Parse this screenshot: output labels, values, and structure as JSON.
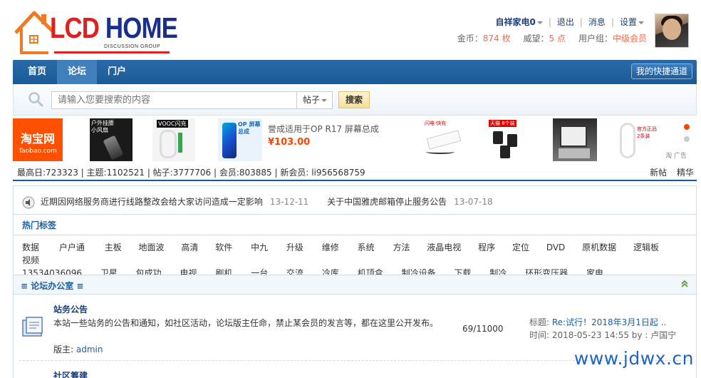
{
  "logo": {
    "part1": "LCD",
    "part2": "HOME",
    "subtitle": "DISCUSSION GROUP"
  },
  "user": {
    "name": "自祥家电0",
    "logout": "退出",
    "messages": "消息",
    "settings": "设置",
    "coins_label": "金币：",
    "coins_value": "874 枚",
    "prestige_label": "威望：",
    "prestige_value": "5 点",
    "group_label": "用户组：",
    "group_value": "中级会员"
  },
  "nav": {
    "items": [
      {
        "label": "首页"
      },
      {
        "label": "论坛",
        "active": true
      },
      {
        "label": "门户"
      }
    ],
    "quick_access": "我的快捷通道"
  },
  "search": {
    "placeholder": "请输入您要搜索的内容",
    "type": "帖子",
    "button": "搜索"
  },
  "ad": {
    "taobao_cn": "淘宝网",
    "taobao_en": "Taobao.com",
    "thumb1_text": "户外挂腰 小风扇",
    "thumb2_text": "VOOC闪充",
    "thumb3_text": "OP 屏幕总成",
    "promo_title": "誉成适用于OP R17 屏幕总成",
    "promo_price": "¥103.00",
    "thumb_usb_text": "闪电·快充",
    "thumb_plug_text": "天猫 8个装",
    "thumb_cable_text": "官方正品 2条装",
    "tag": "淘 广告"
  },
  "stats": {
    "text": "最高日:723323 | 主题:1102521 | 帖子:3777706 | 会员:803885 | 新会员: li956568759",
    "new_posts": "新帖",
    "digest": "精华"
  },
  "notices": [
    {
      "title": "近期因网络服务商进行线路整改会给大家访问造成一定影响",
      "date": "13-12-11"
    },
    {
      "title": "关于中国雅虎邮箱停止服务公告",
      "date": "13-07-18"
    }
  ],
  "hot_tags": {
    "title": "热门标签",
    "tags": [
      "数据",
      "户户通",
      "主板",
      "地面波",
      "高清",
      "软件",
      "中九",
      "升级",
      "维修",
      "系统",
      "方法",
      "液晶电视",
      "程序",
      "定位",
      "DVD",
      "原机数据",
      "逻辑板",
      "视频",
      "13534036096",
      "卫星",
      "包成功",
      "电视",
      "刷机",
      "一台",
      "交流",
      "冷库",
      "机顶盒",
      "制冷设备",
      "下载",
      "制冷",
      "环形变压器",
      "家电"
    ]
  },
  "section": {
    "title": "≡ 论坛办公室 ≡",
    "forums": [
      {
        "name": "站务公告",
        "desc": "本站一些站务的公告和通知，如社区活动，论坛版主任命，禁止某会员的发言等，都在这里公开发布。",
        "moderator_label": "版主: ",
        "moderator": "admin",
        "counts": "69/11000",
        "last_title_label": "标题: ",
        "last_title": "Re:试行！2018年3月1日起 ..",
        "last_time": "时间: 2018-05-23 14:55 by : 卢国宁"
      },
      {
        "name": "社区筹建"
      }
    ]
  },
  "watermark": "www.jdwx.cn",
  "colors": {
    "nav_blue": "#195a96",
    "accent_orange": "#f26c4f",
    "link_blue": "#1b5fa3",
    "taobao": "#ff5000"
  }
}
